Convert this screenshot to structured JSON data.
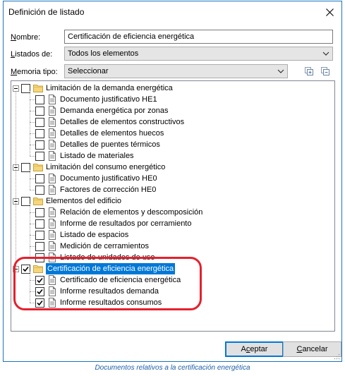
{
  "window": {
    "title": "Definición de listado"
  },
  "form": {
    "nombre_label": "Nombre:",
    "nombre_value": "Certificación de eficiencia energética",
    "listados_label": "Listados de:",
    "listados_value": "Todos los elementos",
    "memoria_label": "Memoria tipo:",
    "memoria_value": "Seleccionar"
  },
  "tree": {
    "groups": [
      {
        "label": "Limitación de la demanda energética",
        "checked": false,
        "items": [
          {
            "label": "Documento justificativo HE1",
            "checked": false
          },
          {
            "label": "Demanda energética por zonas",
            "checked": false
          },
          {
            "label": "Detalles de elementos constructivos",
            "checked": false
          },
          {
            "label": "Detalles de elementos huecos",
            "checked": false
          },
          {
            "label": "Detalles de puentes térmicos",
            "checked": false
          },
          {
            "label": "Listado de materiales",
            "checked": false
          }
        ]
      },
      {
        "label": "Limitación del consumo energético",
        "checked": false,
        "items": [
          {
            "label": "Documento justificativo HE0",
            "checked": false
          },
          {
            "label": "Factores de corrección HE0",
            "checked": false
          }
        ]
      },
      {
        "label": "Elementos del edificio",
        "checked": false,
        "items": [
          {
            "label": "Relación de elementos y descomposición",
            "checked": false
          },
          {
            "label": "Informe de resultados por cerramiento",
            "checked": false
          },
          {
            "label": "Listado de espacios",
            "checked": false
          },
          {
            "label": "Medición de cerramientos",
            "checked": false
          },
          {
            "label": "Listado de unidades de uso",
            "checked": false
          }
        ]
      },
      {
        "label": "Certificación de eficiencia energética",
        "checked": true,
        "selected": true,
        "items": [
          {
            "label": "Certificado de eficiencia energética",
            "checked": true
          },
          {
            "label": "Informe resultados demanda",
            "checked": true
          },
          {
            "label": "Informe resultados consumos",
            "checked": true
          }
        ]
      }
    ]
  },
  "buttons": {
    "accept": "Aceptar",
    "cancel": "Cancelar"
  },
  "caption": "Documentos relativos a la certificación energética",
  "colors": {
    "window_border": "#1c75bc",
    "selection": "#0078d7",
    "highlight": "#e5202d",
    "caption": "#1f5fa8"
  }
}
